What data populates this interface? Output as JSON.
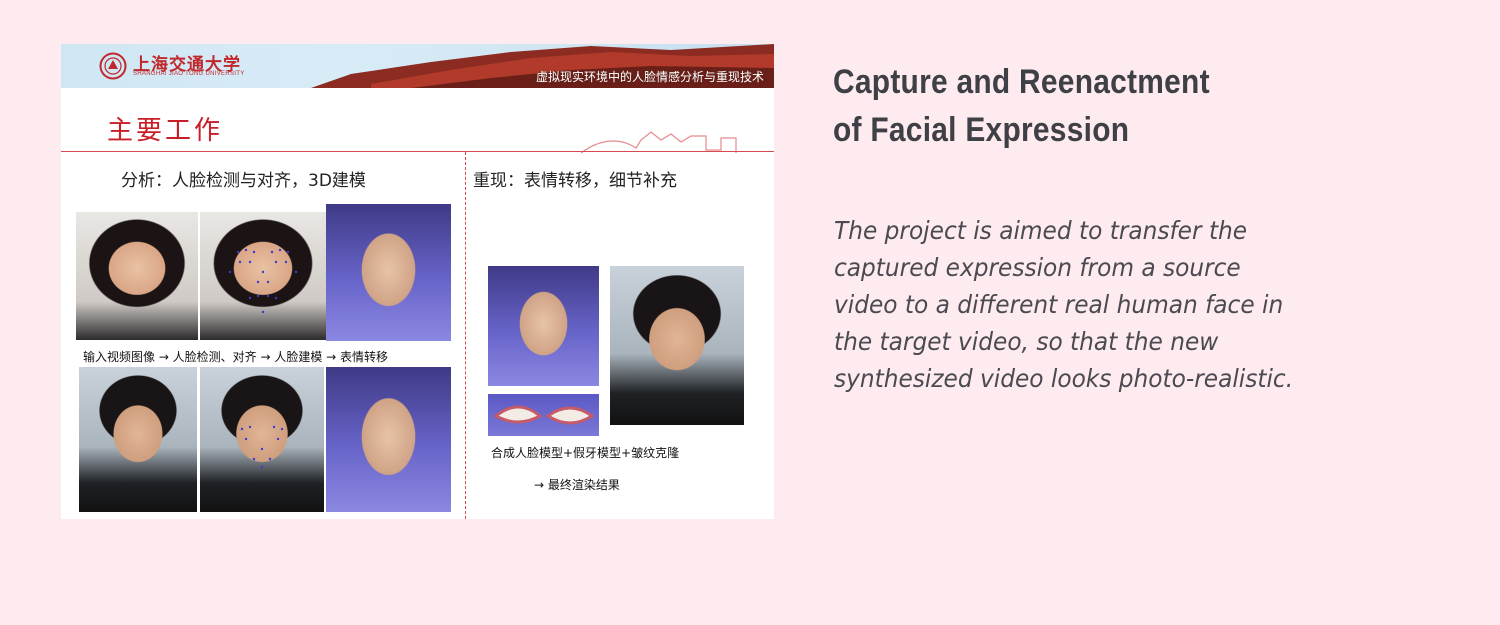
{
  "slide": {
    "university_cn": "上海交通大学",
    "university_en": "SHANGHAI JIAO TONG UNIVERSITY",
    "banner_text": "虚拟现实环境中的人脸情感分析与重现技术",
    "title": "主要工作",
    "left_heading": "分析：人脸检测与对齐，3D建模",
    "right_heading": "重现：表情转移，细节补充",
    "pipeline_caption": "输入视频图像 → 人脸检测、对齐 → 人脸建模 → 表情转移",
    "right_caption_1": "合成人脸模型+假牙模型+皱纹克隆",
    "right_caption_2": "→ 最终渲染结果"
  },
  "heading": "Capture and Reenactment of Facial Expression",
  "description": "The project is aimed to transfer the captured expression from a source video to a different real human face in the target video, so that the new synthesized video looks photo-realistic.",
  "colors": {
    "page_background": "#fdebef",
    "slide_title": "#c81e28",
    "heading_text": "#3f3f46",
    "body_text": "#4a4a50"
  }
}
